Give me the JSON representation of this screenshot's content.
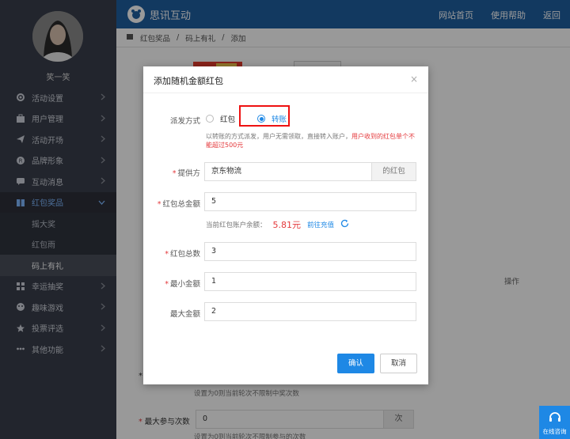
{
  "user": {
    "name": "笑一笑"
  },
  "topbar": {
    "brand": "思讯互动",
    "links": [
      "网站首页",
      "使用帮助",
      "返回"
    ]
  },
  "breadcrumb": [
    "红包奖品",
    "码上有礼",
    "添加"
  ],
  "sidebar": {
    "menu_before": [
      {
        "label": "活动设置",
        "icon": "gear-icon"
      },
      {
        "label": "用户管理",
        "icon": "user-icon"
      },
      {
        "label": "活动开场",
        "icon": "send-icon"
      },
      {
        "label": "品牌形象",
        "icon": "registered-icon"
      },
      {
        "label": "互动消息",
        "icon": "chat-icon"
      }
    ],
    "active": {
      "label": "红包奖品",
      "icon": "gift-icon"
    },
    "sub_items": [
      "摇大奖",
      "红包雨",
      "码上有礼"
    ],
    "menu_after": [
      {
        "label": "幸运抽奖",
        "icon": "grid-icon"
      },
      {
        "label": "趣味游戏",
        "icon": "game-icon"
      },
      {
        "label": "投票评选",
        "icon": "star-icon"
      },
      {
        "label": "其他功能",
        "icon": "more-icon"
      }
    ]
  },
  "background": {
    "ops_header": "操作",
    "hint1": "设置为0则当前轮次不限制中奖次数",
    "field_label": "最大参与次数",
    "field_value": "0",
    "field_unit": "次",
    "hint2": "设置为0则当前轮次不限制参与的次数"
  },
  "modal": {
    "title": "添加随机金额红包",
    "close": "×",
    "method_label": "派发方式",
    "option1": "红包",
    "option2": "转账",
    "hint_normal": "以转账的方式派发，用户无需领取，直接转入账户，",
    "hint_warn": "用户收到的红包单个不能超过500元",
    "provider_label": "提供方",
    "provider_value": "京东物流",
    "provider_suffix": "的红包",
    "total_amount_label": "红包总金额",
    "total_amount_value": "5",
    "balance_label": "当前红包账户余额：",
    "balance_amount": "5.81元",
    "recharge_link": "前往充值",
    "total_count_label": "红包总数",
    "total_count_value": "3",
    "min_label": "最小金额",
    "min_value": "1",
    "max_label": "最大金额",
    "max_value": "2",
    "confirm": "确认",
    "cancel": "取消"
  },
  "chat_widget": {
    "label": "在线咨询"
  }
}
